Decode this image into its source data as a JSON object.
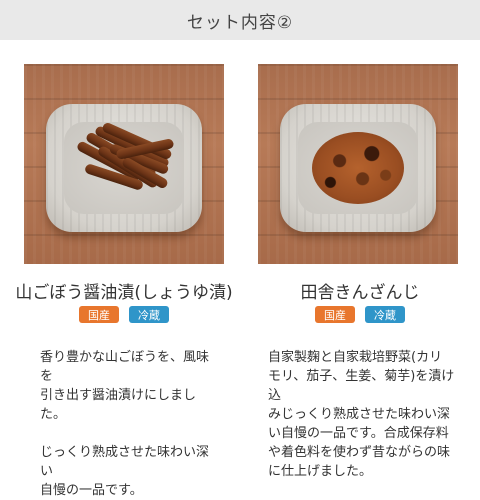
{
  "header": {
    "title": "セット内容②"
  },
  "products": [
    {
      "name": "山ごぼう醤油漬(しょうゆ漬)",
      "tags": [
        "国産",
        "冷蔵"
      ],
      "desc_p1": "香り豊かな山ごぼうを、風味を\n引き出す醤油漬けにしました。",
      "desc_p2": "じっくり熟成させた味わい深い\n自慢の一品です。"
    },
    {
      "name": "田舎きんざんじ",
      "tags": [
        "国産",
        "冷蔵"
      ],
      "desc_p1": "自家製麹と自家栽培野菜(カリ\nモリ、茄子、生姜、菊芋)を漬け込\nみじっくり熟成させた味わい深\nい自慢の一品です。合成保存料\nや着色料を使わず昔ながらの味\nに仕上げました。",
      "desc_p2": ""
    }
  ],
  "colors": {
    "origin_tag": "#e8762d",
    "cold_tag": "#2f95c9",
    "header_bg": "#e9e9e9"
  }
}
